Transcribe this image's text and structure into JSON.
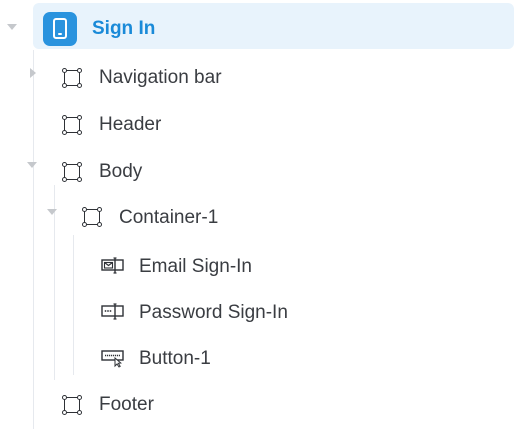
{
  "tree": {
    "root": {
      "label": "Sign In",
      "icon": "phone-screen-icon",
      "expanded": true,
      "selected": true
    },
    "items": [
      {
        "label": "Navigation bar",
        "icon": "container-icon",
        "expanded": false
      },
      {
        "label": "Header",
        "icon": "container-icon"
      },
      {
        "label": "Body",
        "icon": "container-icon",
        "expanded": true
      },
      {
        "label": "Container-1",
        "icon": "container-icon",
        "expanded": true
      },
      {
        "label": "Email Sign-In",
        "icon": "email-input-icon"
      },
      {
        "label": "Password Sign-In",
        "icon": "password-input-icon"
      },
      {
        "label": "Button-1",
        "icon": "button-component-icon"
      },
      {
        "label": "Footer",
        "icon": "container-icon"
      }
    ]
  },
  "colors": {
    "selection_bg": "#e8f3fc",
    "selection_text": "#1a8ad8",
    "badge": "#2a93de",
    "text": "#3a3d42",
    "caret": "#c5c8cc",
    "guide": "#e6e9ee"
  }
}
